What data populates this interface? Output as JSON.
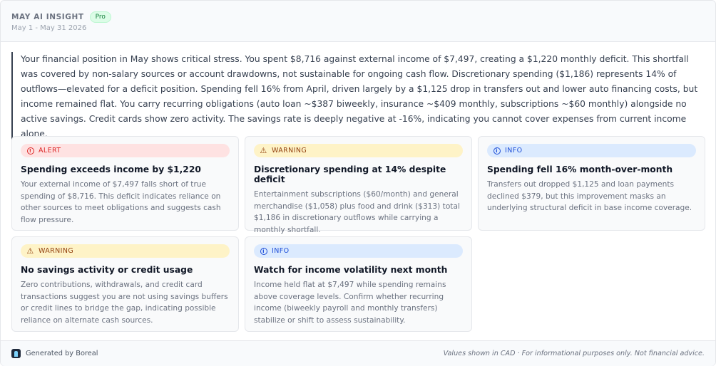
{
  "header": {
    "title": "MAY AI INSIGHT",
    "badge": "Pro",
    "date_range": "May 1 - May 31 2026"
  },
  "summary": "Your financial position in May shows critical stress. You spent $8,716 against external income of $7,497, creating a $1,220 monthly deficit. This shortfall was covered by non-salary sources or account drawdowns, not sustainable for ongoing cash flow. Discretionary spending ($1,186) represents 14% of outflows—elevated for a deficit position. Spending fell 16% from April, driven largely by a $1,125 drop in transfers out and lower auto financing costs, but income remained flat. You carry recurring obligations (auto loan ~$387 biweekly, insurance ~$409 monthly, subscriptions ~$60 monthly) alongside no active savings. Credit cards show zero activity. The savings rate is deeply negative at -16%, indicating you cannot cover expenses from current income alone.",
  "cards": [
    {
      "level": "ALERT",
      "icon": "alert-circle-icon",
      "title": "Spending exceeds income by $1,220",
      "body": "Your external income of $7,497 falls short of true spending of $8,716. This deficit indicates reliance on other sources to meet obligations and suggests cash flow pressure."
    },
    {
      "level": "WARNING",
      "icon": "warning-triangle-icon",
      "title": "Discretionary spending at 14% despite deficit",
      "body": "Entertainment subscriptions ($60/month) and general merchandise ($1,058) plus food and drink ($313) total $1,186 in discretionary outflows while carrying a monthly shortfall."
    },
    {
      "level": "INFO",
      "icon": "info-circle-icon",
      "title": "Spending fell 16% month-over-month",
      "body": "Transfers out dropped $1,125 and loan payments declined $379, but this improvement masks an underlying structural deficit in base income coverage."
    },
    {
      "level": "WARNING",
      "icon": "warning-triangle-icon",
      "title": "No savings activity or credit usage",
      "body": "Zero contributions, withdrawals, and credit card transactions suggest you are not using savings buffers or credit lines to bridge the gap, indicating possible reliance on alternate cash sources."
    },
    {
      "level": "INFO",
      "icon": "info-circle-icon",
      "title": "Watch for income volatility next month",
      "body": "Income held flat at $7,497 while spending remains above coverage levels. Confirm whether recurring income (biweekly payroll and monthly transfers) stabilize or shift to assess sustainability."
    }
  ],
  "footer": {
    "generated_by": "Generated by Boreal",
    "disclaimer": "Values shown in CAD · For informational purposes only. Not financial advice."
  },
  "colors": {
    "alert": "#dc2626",
    "warning": "#92400e",
    "info": "#1d4ed8",
    "pro_badge": "#15803d"
  }
}
